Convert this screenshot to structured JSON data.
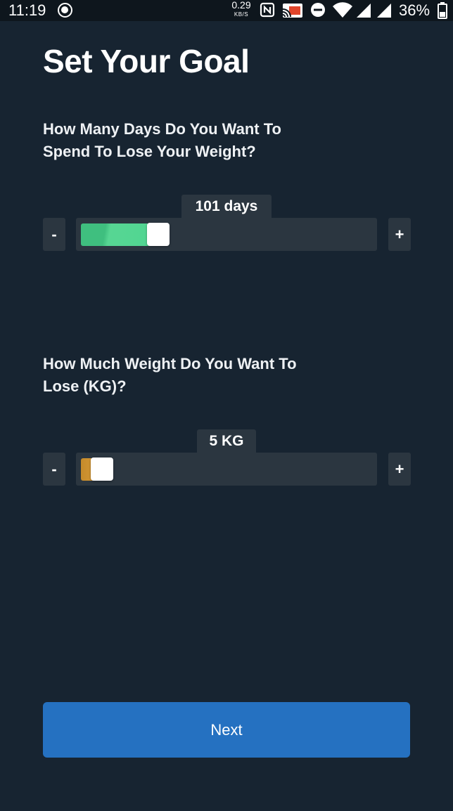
{
  "status_bar": {
    "time": "11:19",
    "net_speed_value": "0.29",
    "net_speed_unit": "KB/S",
    "battery_percent": "36%",
    "icons": [
      "recording-icon",
      "nfc-icon",
      "cast-icon",
      "do-not-disturb-icon",
      "wifi-icon",
      "signal-icon",
      "signal-icon",
      "battery-icon"
    ]
  },
  "page": {
    "title": "Set Your Goal"
  },
  "days_goal": {
    "question": "How Many Days Do You Want To Spend To Lose Your Weight?",
    "value_label": "101 days",
    "fill_fraction": 0.23,
    "fill_color": "#4fd592",
    "decrement_label": "-",
    "increment_label": "+"
  },
  "weight_goal": {
    "question": "How Much Weight Do You Want To Lose (KG)?",
    "value_label": "5 KG",
    "fill_fraction": 0.02,
    "fill_color": "#d89a36",
    "decrement_label": "-",
    "increment_label": "+"
  },
  "actions": {
    "next_label": "Next",
    "next_color": "#2571c1"
  }
}
